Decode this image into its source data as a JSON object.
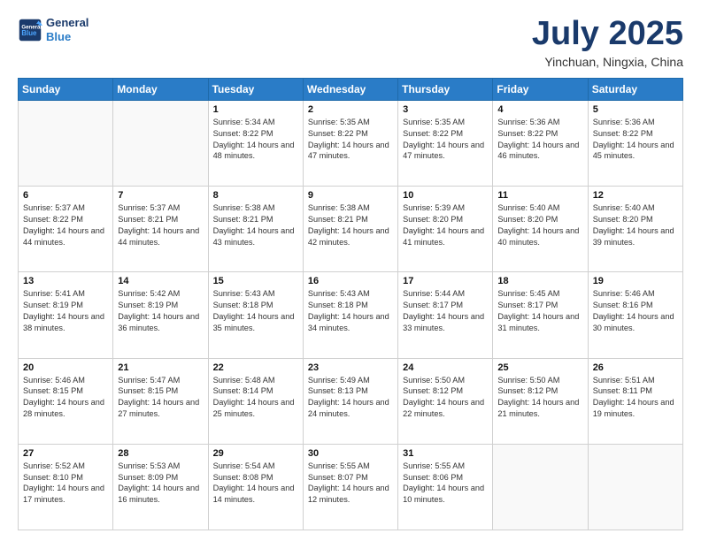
{
  "header": {
    "logo_line1": "General",
    "logo_line2": "Blue",
    "month": "July 2025",
    "location": "Yinchuan, Ningxia, China"
  },
  "days_of_week": [
    "Sunday",
    "Monday",
    "Tuesday",
    "Wednesday",
    "Thursday",
    "Friday",
    "Saturday"
  ],
  "weeks": [
    [
      {
        "day": "",
        "info": ""
      },
      {
        "day": "",
        "info": ""
      },
      {
        "day": "1",
        "info": "Sunrise: 5:34 AM\nSunset: 8:22 PM\nDaylight: 14 hours and 48 minutes."
      },
      {
        "day": "2",
        "info": "Sunrise: 5:35 AM\nSunset: 8:22 PM\nDaylight: 14 hours and 47 minutes."
      },
      {
        "day": "3",
        "info": "Sunrise: 5:35 AM\nSunset: 8:22 PM\nDaylight: 14 hours and 47 minutes."
      },
      {
        "day": "4",
        "info": "Sunrise: 5:36 AM\nSunset: 8:22 PM\nDaylight: 14 hours and 46 minutes."
      },
      {
        "day": "5",
        "info": "Sunrise: 5:36 AM\nSunset: 8:22 PM\nDaylight: 14 hours and 45 minutes."
      }
    ],
    [
      {
        "day": "6",
        "info": "Sunrise: 5:37 AM\nSunset: 8:22 PM\nDaylight: 14 hours and 44 minutes."
      },
      {
        "day": "7",
        "info": "Sunrise: 5:37 AM\nSunset: 8:21 PM\nDaylight: 14 hours and 44 minutes."
      },
      {
        "day": "8",
        "info": "Sunrise: 5:38 AM\nSunset: 8:21 PM\nDaylight: 14 hours and 43 minutes."
      },
      {
        "day": "9",
        "info": "Sunrise: 5:38 AM\nSunset: 8:21 PM\nDaylight: 14 hours and 42 minutes."
      },
      {
        "day": "10",
        "info": "Sunrise: 5:39 AM\nSunset: 8:20 PM\nDaylight: 14 hours and 41 minutes."
      },
      {
        "day": "11",
        "info": "Sunrise: 5:40 AM\nSunset: 8:20 PM\nDaylight: 14 hours and 40 minutes."
      },
      {
        "day": "12",
        "info": "Sunrise: 5:40 AM\nSunset: 8:20 PM\nDaylight: 14 hours and 39 minutes."
      }
    ],
    [
      {
        "day": "13",
        "info": "Sunrise: 5:41 AM\nSunset: 8:19 PM\nDaylight: 14 hours and 38 minutes."
      },
      {
        "day": "14",
        "info": "Sunrise: 5:42 AM\nSunset: 8:19 PM\nDaylight: 14 hours and 36 minutes."
      },
      {
        "day": "15",
        "info": "Sunrise: 5:43 AM\nSunset: 8:18 PM\nDaylight: 14 hours and 35 minutes."
      },
      {
        "day": "16",
        "info": "Sunrise: 5:43 AM\nSunset: 8:18 PM\nDaylight: 14 hours and 34 minutes."
      },
      {
        "day": "17",
        "info": "Sunrise: 5:44 AM\nSunset: 8:17 PM\nDaylight: 14 hours and 33 minutes."
      },
      {
        "day": "18",
        "info": "Sunrise: 5:45 AM\nSunset: 8:17 PM\nDaylight: 14 hours and 31 minutes."
      },
      {
        "day": "19",
        "info": "Sunrise: 5:46 AM\nSunset: 8:16 PM\nDaylight: 14 hours and 30 minutes."
      }
    ],
    [
      {
        "day": "20",
        "info": "Sunrise: 5:46 AM\nSunset: 8:15 PM\nDaylight: 14 hours and 28 minutes."
      },
      {
        "day": "21",
        "info": "Sunrise: 5:47 AM\nSunset: 8:15 PM\nDaylight: 14 hours and 27 minutes."
      },
      {
        "day": "22",
        "info": "Sunrise: 5:48 AM\nSunset: 8:14 PM\nDaylight: 14 hours and 25 minutes."
      },
      {
        "day": "23",
        "info": "Sunrise: 5:49 AM\nSunset: 8:13 PM\nDaylight: 14 hours and 24 minutes."
      },
      {
        "day": "24",
        "info": "Sunrise: 5:50 AM\nSunset: 8:12 PM\nDaylight: 14 hours and 22 minutes."
      },
      {
        "day": "25",
        "info": "Sunrise: 5:50 AM\nSunset: 8:12 PM\nDaylight: 14 hours and 21 minutes."
      },
      {
        "day": "26",
        "info": "Sunrise: 5:51 AM\nSunset: 8:11 PM\nDaylight: 14 hours and 19 minutes."
      }
    ],
    [
      {
        "day": "27",
        "info": "Sunrise: 5:52 AM\nSunset: 8:10 PM\nDaylight: 14 hours and 17 minutes."
      },
      {
        "day": "28",
        "info": "Sunrise: 5:53 AM\nSunset: 8:09 PM\nDaylight: 14 hours and 16 minutes."
      },
      {
        "day": "29",
        "info": "Sunrise: 5:54 AM\nSunset: 8:08 PM\nDaylight: 14 hours and 14 minutes."
      },
      {
        "day": "30",
        "info": "Sunrise: 5:55 AM\nSunset: 8:07 PM\nDaylight: 14 hours and 12 minutes."
      },
      {
        "day": "31",
        "info": "Sunrise: 5:55 AM\nSunset: 8:06 PM\nDaylight: 14 hours and 10 minutes."
      },
      {
        "day": "",
        "info": ""
      },
      {
        "day": "",
        "info": ""
      }
    ]
  ]
}
